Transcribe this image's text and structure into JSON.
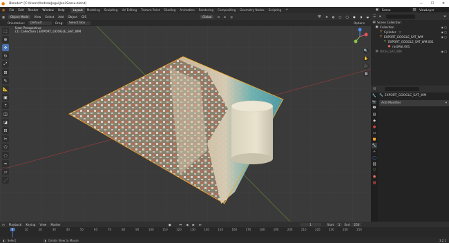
{
  "window": {
    "title": "Blender* [C:\\Users\\Andrea\\Jegui\\Jeni\\Sassu.blend]",
    "minimize": "—",
    "maximize": "☐",
    "close": "✕"
  },
  "menus": [
    "File",
    "Edit",
    "Render",
    "Window",
    "Help"
  ],
  "workspaces": [
    "Layout",
    "Modeling",
    "Sculpting",
    "UV Editing",
    "Texture Paint",
    "Shading",
    "Animation",
    "Rendering",
    "Compositing",
    "Geometry Nodes",
    "Scripting"
  ],
  "active_workspace": "Layout",
  "scene_label": "Scene",
  "view_layer_label": "ViewLayer",
  "viewport_header": {
    "mode": "Object Mode",
    "menus": [
      "View",
      "Select",
      "Add",
      "Object",
      "GIS"
    ],
    "transform": "Global",
    "options": "Options"
  },
  "tool_header": {
    "orientation_label": "Orientation:",
    "orientation_value": "Default",
    "drag_label": "Drag:",
    "drag_value": "Select Box"
  },
  "viewport_info": {
    "line1": "User Perspective",
    "line2": "(1) Collection | EXPORT_GOOGLE_SAT_WM"
  },
  "outliner": {
    "search_placeholder": "",
    "rows": [
      {
        "label": "Scene Collection",
        "indent": 0,
        "icon": "collection-icon"
      },
      {
        "label": "Collection",
        "indent": 1,
        "icon": "collection-icon"
      },
      {
        "label": "Cylinder",
        "indent": 2,
        "icon": "mesh-icon"
      },
      {
        "label": "EXPORT_GOOGLE_SAT_WM",
        "indent": 2,
        "icon": "mesh-icon"
      },
      {
        "label": "EXPORT_GOOGLE_SAT_WM.001",
        "indent": 3,
        "icon": "mesh-icon"
      },
      {
        "label": "rastMat.001",
        "indent": 4,
        "icon": "material-icon"
      },
      {
        "label": "Ortho_SAT_WM",
        "indent": 1,
        "icon": "image-icon"
      }
    ]
  },
  "properties": {
    "object_name": "EXPORT_GOOGLE_SAT_WM",
    "add_modifier": "Add Modifier"
  },
  "timeline": {
    "menus": [
      "Playback",
      "Keying",
      "View",
      "Marker"
    ],
    "current_frame": "1",
    "start_label": "Start",
    "start_value": "1",
    "end_label": "End",
    "end_value": "250",
    "ticks": [
      "0",
      "10",
      "20",
      "30",
      "40",
      "50",
      "60",
      "70",
      "80",
      "90",
      "100",
      "110",
      "120",
      "130",
      "140",
      "150",
      "160",
      "170",
      "180",
      "190",
      "200",
      "210",
      "220",
      "230",
      "240",
      "250"
    ]
  },
  "statusbar": {
    "select": "Select",
    "center": "Center View to Mouse",
    "version": "3.2.1"
  }
}
